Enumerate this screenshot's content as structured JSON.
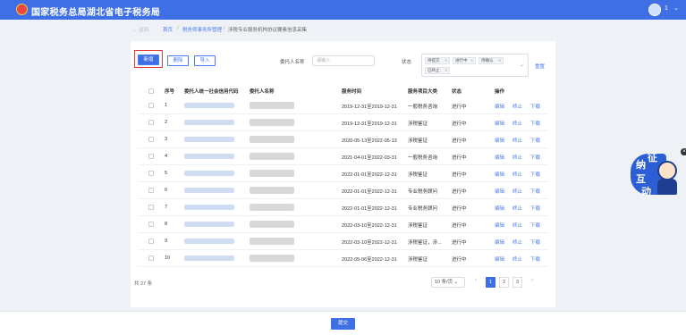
{
  "header": {
    "title": "国家税务总局湖北省电子税务局",
    "user_num": "1",
    "user_caret": "⌄"
  },
  "breadcrumb": {
    "back": "← 返回",
    "home": "首页",
    "sep": "/",
    "mgmt": "税务师事务所管理",
    "current": "涉税专业服务机构协议要素信息采集"
  },
  "toolbar": {
    "add": "新增",
    "delete": "删除",
    "import": "导入"
  },
  "filters": {
    "client_label": "委托人名称",
    "client_placeholder": "请输入",
    "status_label": "状态",
    "status_tags": [
      "待提交",
      "进行中",
      "待确认",
      "已终止"
    ],
    "reset": "重置"
  },
  "table": {
    "headers": [
      "序号",
      "委托人统一社会信用代码",
      "委托人名称",
      "服务时间",
      "服务项目大类",
      "状态",
      "操作"
    ],
    "actions": [
      "编辑",
      "终止",
      "下载"
    ],
    "rows": [
      {
        "no": "1",
        "time": "2019-12-31至2019-12-31",
        "type": "一般税务咨询",
        "status": "进行中"
      },
      {
        "no": "2",
        "time": "2019-12-31至2019-12-31",
        "type": "涉税鉴证",
        "status": "进行中"
      },
      {
        "no": "3",
        "time": "2020-05-13至2022-05-13",
        "type": "涉税鉴证",
        "status": "进行中"
      },
      {
        "no": "4",
        "time": "2021-04-01至2022-03-31",
        "type": "一般税务咨询",
        "status": "进行中"
      },
      {
        "no": "5",
        "time": "2022-01-01至2022-12-31",
        "type": "涉税鉴证",
        "status": "进行中"
      },
      {
        "no": "6",
        "time": "2022-01-01至2022-12-31",
        "type": "专业税务顾问",
        "status": "进行中"
      },
      {
        "no": "7",
        "time": "2022-01-01至2022-12-31",
        "type": "专业税务顾问",
        "status": "进行中"
      },
      {
        "no": "8",
        "time": "2022-03-10至2022-12-31",
        "type": "涉税鉴证",
        "status": "进行中"
      },
      {
        "no": "9",
        "time": "2022-03-10至2022-12-31",
        "type": "涉税鉴证，涉...",
        "status": "进行中"
      },
      {
        "no": "10",
        "time": "2022-05-06至2022-12-31",
        "type": "涉税鉴证",
        "status": "进行中"
      }
    ]
  },
  "pagination": {
    "total": "共 27 条",
    "page_size": "10 条/页",
    "pages": [
      "1",
      "2",
      "3"
    ],
    "prev": "‹",
    "next": "›"
  },
  "footer": {
    "submit": "提交"
  },
  "mascot": {
    "chars": [
      "征",
      "纳",
      "互",
      "动"
    ],
    "close": "×"
  }
}
